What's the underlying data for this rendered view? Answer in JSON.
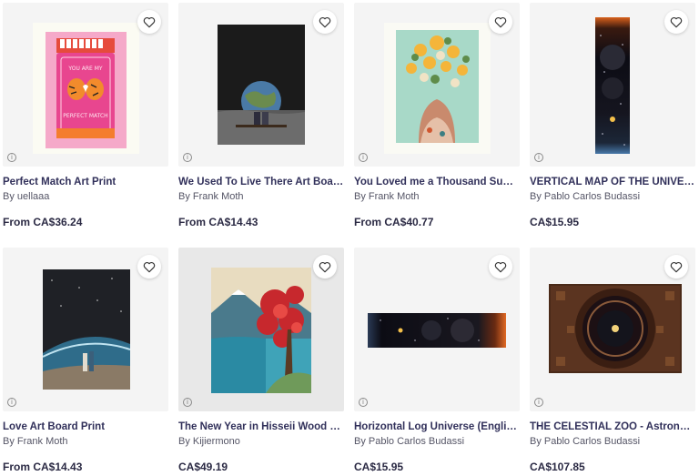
{
  "products": [
    {
      "title": "Perfect Match Art Print",
      "artist": "By uellaaa",
      "price": "From CA$36.24",
      "icon": "heart-icon"
    },
    {
      "title": "We Used To Live There Art Board P...",
      "artist": "By Frank Moth",
      "price": "From CA$14.43",
      "icon": "heart-icon"
    },
    {
      "title": "You Loved me a Thousand Summe...",
      "artist": "By Frank Moth",
      "price": "From CA$40.77",
      "icon": "heart-icon"
    },
    {
      "title": "VERTICAL MAP OF THE UNIVERSE ...",
      "artist": "By Pablo Carlos Budassi",
      "price": "CA$15.95",
      "icon": "heart-icon"
    },
    {
      "title": "Love Art Board Print",
      "artist": "By Frank Moth",
      "price": "From CA$14.43",
      "icon": "heart-icon"
    },
    {
      "title": "The New Year in Hisseii Wood Mou...",
      "artist": "By Kijiermono",
      "price": "CA$49.19",
      "icon": "heart-icon"
    },
    {
      "title": "Horizontal Log Universe (English - ...",
      "artist": "By Pablo Carlos Budassi",
      "price": "CA$15.95",
      "icon": "heart-icon"
    },
    {
      "title": "THE CELESTIAL ZOO - Astronomic...",
      "artist": "By Pablo Carlos Budassi",
      "price": "CA$107.85",
      "icon": "heart-icon"
    }
  ],
  "info_glyph": "i",
  "colors": {
    "title": "#31305a",
    "image_bg": "#f4f4f4"
  },
  "artwork_text": {
    "matchbox_top": "YOU ARE MY",
    "matchbox_bottom": "PERFECT MATCH"
  }
}
